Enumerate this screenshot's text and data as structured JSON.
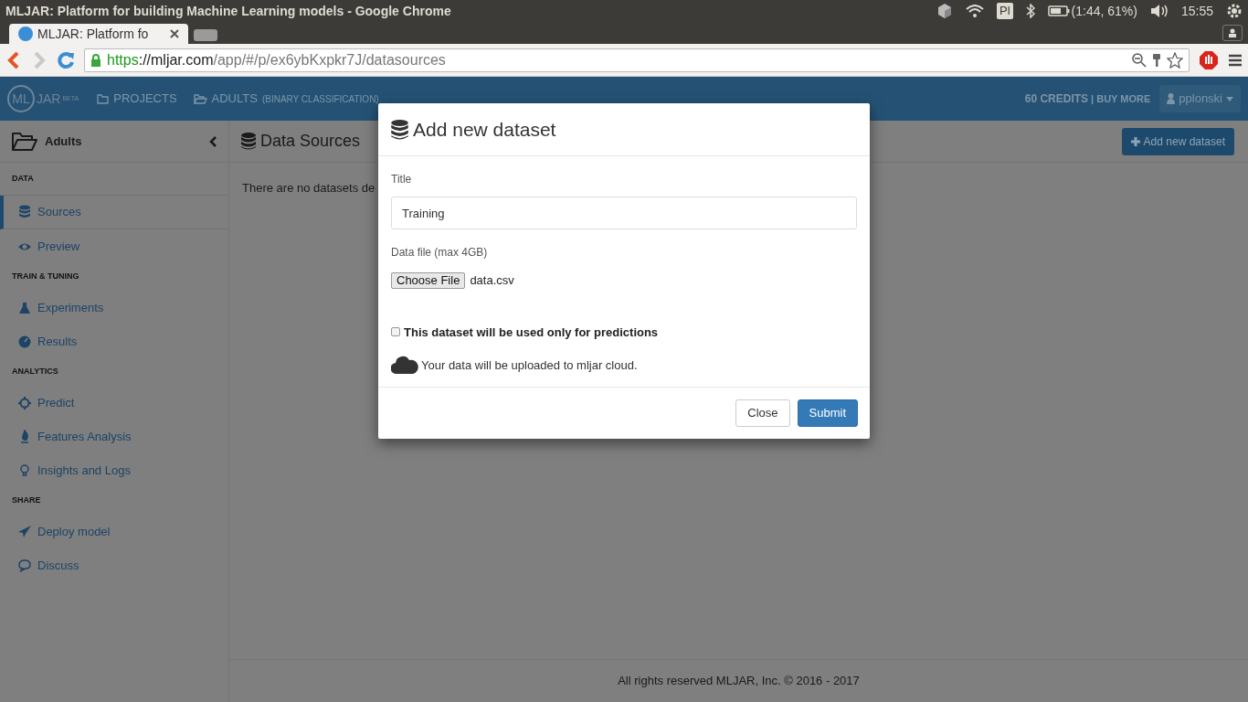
{
  "system_bar": {
    "window_title": "MLJAR: Platform for building Machine Learning models - Google Chrome",
    "keyboard": "Pl",
    "battery": "(1:44, 61%)",
    "time": "15:55"
  },
  "browser": {
    "tab_title": "MLJAR: Platform fo",
    "url_scheme": "https",
    "url_host": "://mljar.com",
    "url_path": "/app/#/p/ex6ybKxpkr7J/datasources"
  },
  "navbar": {
    "logo_left": "ML",
    "logo_right": "JAR",
    "logo_badge": "BETA",
    "links": [
      {
        "label": "PROJECTS"
      },
      {
        "label": "ADULTS",
        "suffix": "(BINARY CLASSIFICATION)"
      }
    ],
    "credits": "60 CREDITS",
    "buy_more": "| BUY MORE",
    "user": "pplonski"
  },
  "sidebar": {
    "project": "Adults",
    "sections": [
      {
        "heading": "DATA",
        "items": [
          {
            "label": "Sources",
            "selected": true
          },
          {
            "label": "Preview",
            "selected": false
          }
        ]
      },
      {
        "heading": "TRAIN & TUNING",
        "items": [
          {
            "label": "Experiments",
            "selected": false
          },
          {
            "label": "Results",
            "selected": false
          }
        ]
      },
      {
        "heading": "ANALYTICS",
        "items": [
          {
            "label": "Predict",
            "selected": false
          },
          {
            "label": "Features Analysis",
            "selected": false
          },
          {
            "label": "Insights and Logs",
            "selected": false
          }
        ]
      },
      {
        "heading": "SHARE",
        "items": [
          {
            "label": "Deploy model",
            "selected": false
          },
          {
            "label": "Discuss",
            "selected": false
          }
        ]
      }
    ]
  },
  "main": {
    "title": "Data Sources",
    "add_button": "Add new dataset",
    "message": "There are no datasets de",
    "footer": "All rights reserved MLJAR, Inc. © 2016 - 2017"
  },
  "modal": {
    "title": "Add new dataset",
    "title_label": "Title",
    "title_value": "Training",
    "file_label": "Data file (max 4GB)",
    "file_button": "Choose File",
    "file_name": "data.csv",
    "predictions_only": {
      "label": "This dataset will be used only for predictions",
      "checked": false
    },
    "note": "Your data will be uploaded to mljar cloud.",
    "buttons": [
      {
        "label": "Close",
        "kind": "default"
      },
      {
        "label": "Submit",
        "kind": "primary"
      }
    ]
  }
}
